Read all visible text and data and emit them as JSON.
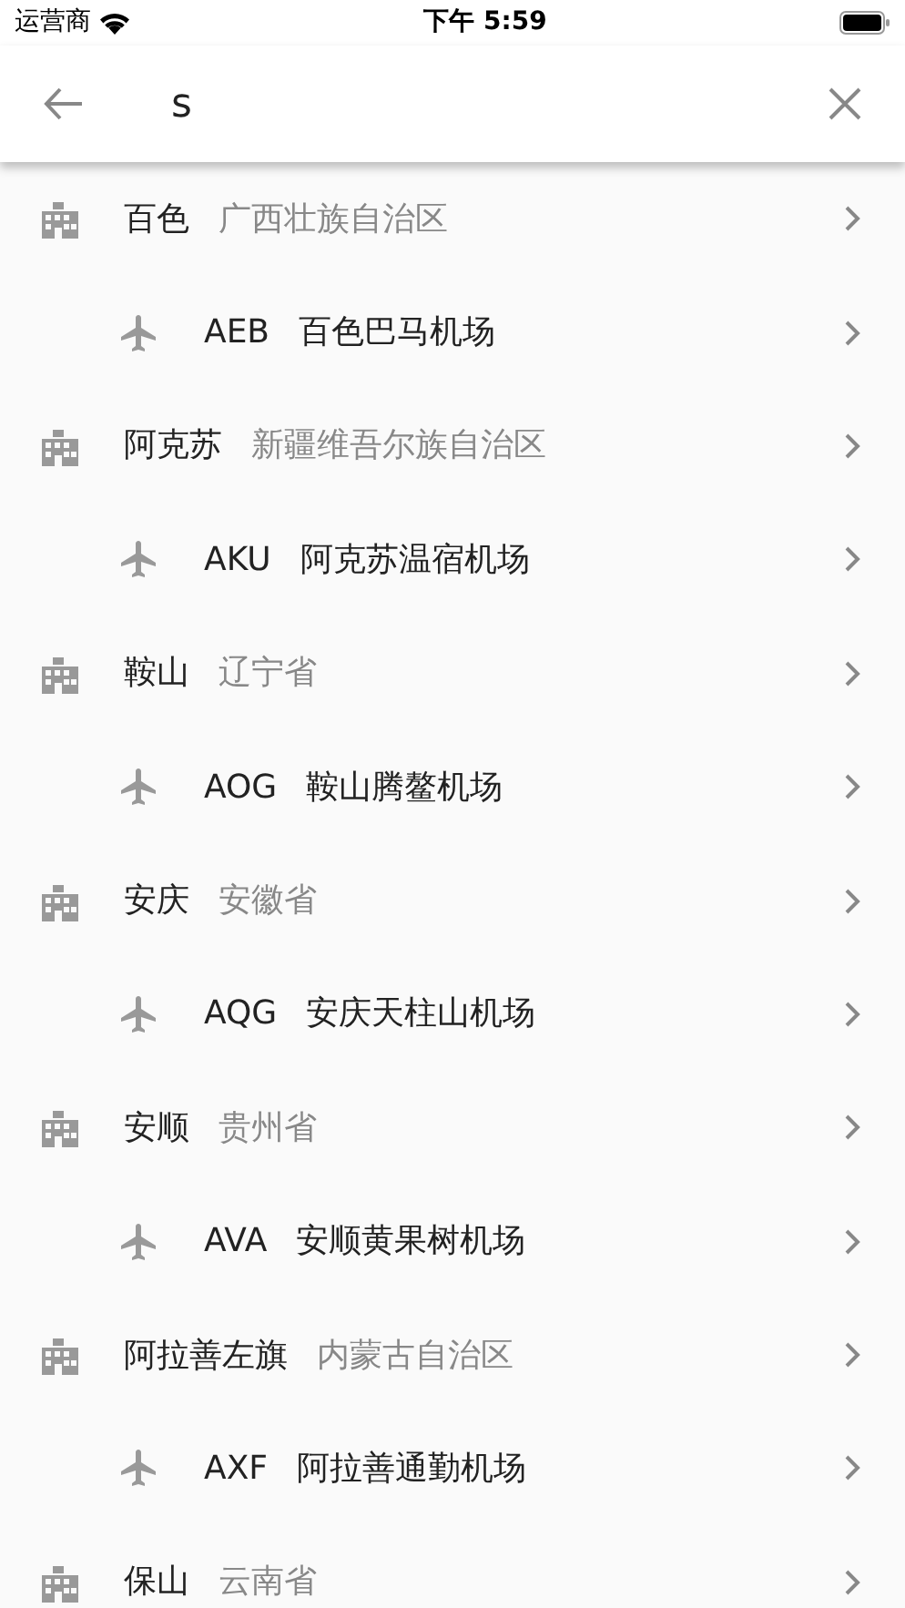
{
  "status_bar": {
    "carrier": "运营商",
    "time": "下午 5:59"
  },
  "search": {
    "value": "s"
  },
  "results": [
    {
      "kind": "city",
      "name": "百色",
      "region": "广西壮族自治区"
    },
    {
      "kind": "airport",
      "code": "AEB",
      "name": "百色巴马机场"
    },
    {
      "kind": "city",
      "name": "阿克苏",
      "region": "新疆维吾尔族自治区"
    },
    {
      "kind": "airport",
      "code": "AKU",
      "name": "阿克苏温宿机场"
    },
    {
      "kind": "city",
      "name": "鞍山",
      "region": "辽宁省"
    },
    {
      "kind": "airport",
      "code": "AOG",
      "name": "鞍山腾鳌机场"
    },
    {
      "kind": "city",
      "name": "安庆",
      "region": "安徽省"
    },
    {
      "kind": "airport",
      "code": "AQG",
      "name": "安庆天柱山机场"
    },
    {
      "kind": "city",
      "name": "安顺",
      "region": "贵州省"
    },
    {
      "kind": "airport",
      "code": "AVA",
      "name": "安顺黄果树机场"
    },
    {
      "kind": "city",
      "name": "阿拉善左旗",
      "region": "内蒙古自治区"
    },
    {
      "kind": "airport",
      "code": "AXF",
      "name": "阿拉善通勤机场"
    },
    {
      "kind": "city",
      "name": "保山",
      "region": "云南省"
    }
  ]
}
